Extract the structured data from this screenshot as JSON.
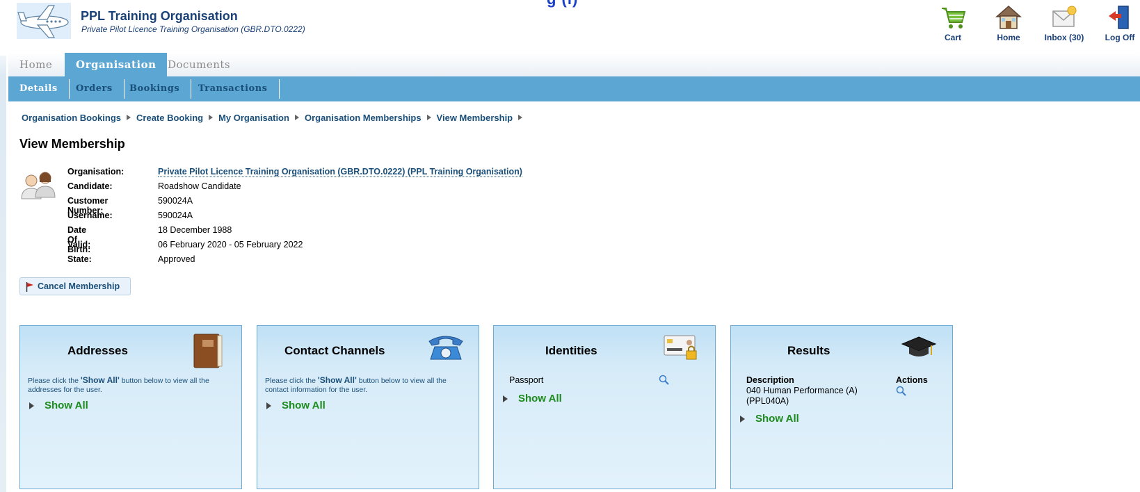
{
  "header": {
    "org_title": "PPL Training Organisation",
    "org_subtitle": "Private Pilot Licence Training Organisation (GBR.DTO.0222)",
    "top_cut_text": "g          (i)",
    "tools": [
      {
        "label": "Cart",
        "icon": "cart-icon"
      },
      {
        "label": "Home",
        "icon": "home-icon"
      },
      {
        "label": "Inbox (30)",
        "icon": "inbox-icon"
      },
      {
        "label": "Log Off",
        "icon": "logoff-icon"
      }
    ]
  },
  "tabs": [
    {
      "label": "Home",
      "active": false
    },
    {
      "label": "Organisation",
      "active": true
    },
    {
      "label": "Documents",
      "active": false
    }
  ],
  "subtabs": [
    {
      "label": "Details",
      "active": true
    },
    {
      "label": "Orders",
      "active": false
    },
    {
      "label": "Bookings",
      "active": false
    },
    {
      "label": "Transactions",
      "active": false
    }
  ],
  "breadcrumb": [
    "Organisation Bookings",
    "Create Booking",
    "My Organisation",
    "Organisation Memberships",
    "View Membership"
  ],
  "page_title": "View Membership",
  "details": [
    {
      "key": "Organisation:",
      "value": "Private Pilot Licence Training Organisation (GBR.DTO.0222) (PPL Training Organisation)"
    },
    {
      "key": "Candidate:",
      "value": "Roadshow Candidate"
    },
    {
      "key": "Customer Number:",
      "value": "590024A"
    },
    {
      "key": "Username:",
      "value": "590024A"
    },
    {
      "key": "Date Of Birth:",
      "value": "18 December 1988"
    },
    {
      "key": "Valid:",
      "value": "06 February 2020 - 05 February 2022"
    },
    {
      "key": "State:",
      "value": "Approved"
    }
  ],
  "cancel_label": "Cancel Membership",
  "panels": {
    "addresses": {
      "title": "Addresses",
      "hint_pre": "Please click the ",
      "hint_bold": "'Show All'",
      "hint_post": " button below to view all the addresses for the user.",
      "show_all": "Show All"
    },
    "contact": {
      "title": "Contact Channels",
      "hint_pre": "Please click the ",
      "hint_bold": "'Show All'",
      "hint_post": " button below to view all the contact information for the user.",
      "show_all": "Show All"
    },
    "identities": {
      "title": "Identities",
      "item": "Passport",
      "show_all": "Show All"
    },
    "results": {
      "title": "Results",
      "col_description": "Description",
      "col_actions": "Actions",
      "row_line1": "040 Human Performance (A)",
      "row_line2": "(PPL040A)",
      "show_all": "Show All"
    }
  },
  "colors": {
    "nav_blue": "#5ca6d3",
    "link_dark": "#1a4f7a",
    "show_all_green": "#1c8a1c"
  }
}
